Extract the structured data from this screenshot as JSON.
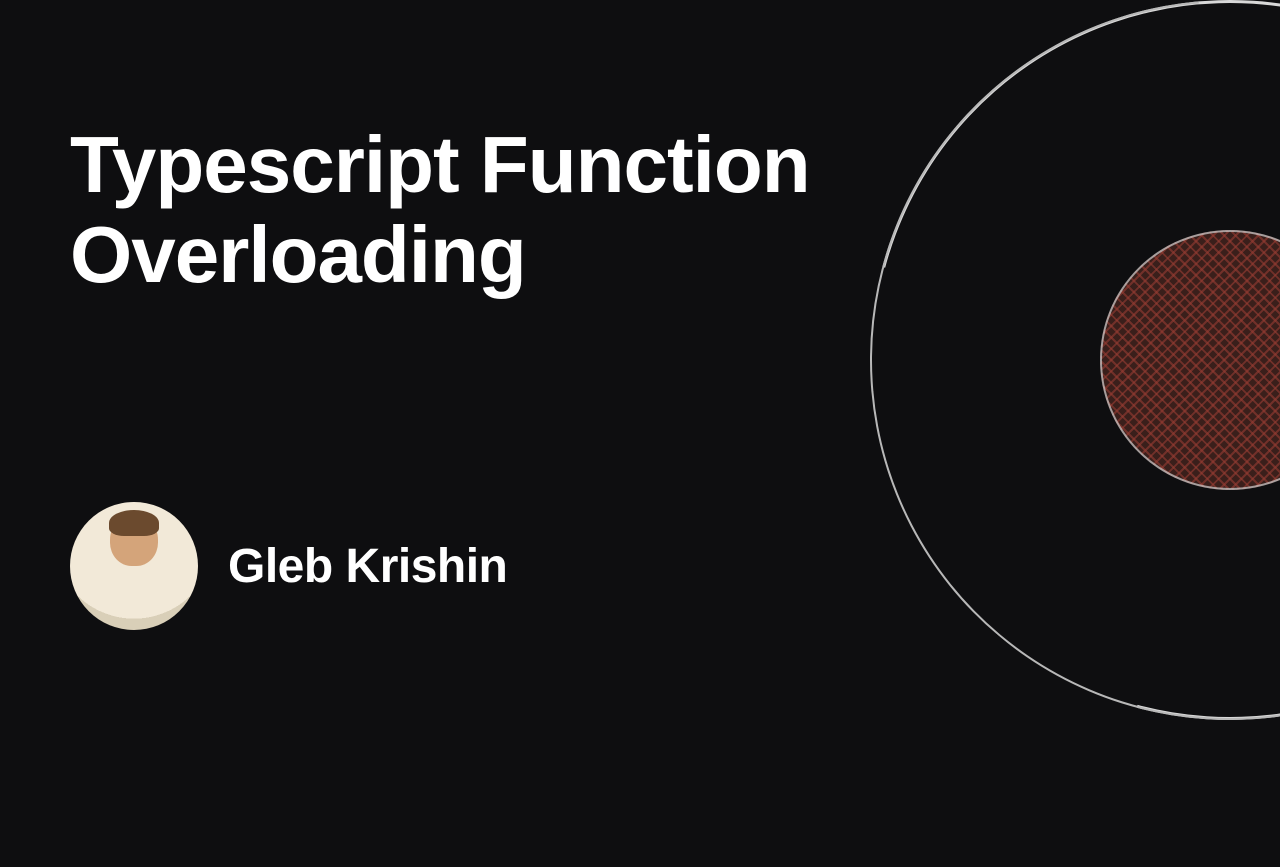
{
  "title": "Typescript Function Overloading",
  "author": {
    "name": "Gleb Krishin"
  },
  "colors": {
    "background": "#0e0e10",
    "text": "#ffffff",
    "accent_circle": "#8b3a2f"
  }
}
